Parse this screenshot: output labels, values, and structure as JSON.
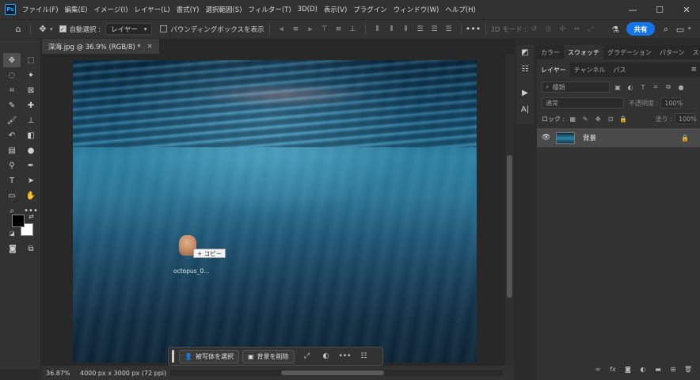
{
  "menubar": {
    "app_icon": "Ps",
    "items": [
      "ファイル(F)",
      "編集(E)",
      "イメージ(I)",
      "レイヤー(L)",
      "書式(Y)",
      "選択範囲(S)",
      "フィルター(T)",
      "3D(D)",
      "表示(V)",
      "プラグイン",
      "ウィンドウ(W)",
      "ヘルプ(H)"
    ],
    "window_controls": [
      "—",
      "☐",
      "✕"
    ]
  },
  "options": {
    "auto_select_label": "自動選択 :",
    "auto_select_target": "レイヤー",
    "bbox_label": "バウンディングボックスを表示",
    "mode_3d_label": "3D モード :",
    "share_label": "共有"
  },
  "document": {
    "tab_title": "深海.jpg @ 36.9% (RGB/8) *",
    "close_glyph": "×",
    "drag_file_label": "octopus_0...",
    "copy_tooltip": "+ コピー"
  },
  "taskbar": {
    "select_subject": "被写体を選択",
    "remove_bg": "背景を削除",
    "more": "•••"
  },
  "status": {
    "zoom": "36.87%",
    "doc_size": "4000 px x 3000 px (72 ppi)",
    "arrow": "›"
  },
  "panels": {
    "top_tabs": [
      "カラー",
      "スウォッチ",
      "グラデーション",
      "パターン",
      "スタイル"
    ],
    "top_active": 1,
    "layer_tabs": [
      "レイヤー",
      "チャンネル",
      "パス"
    ],
    "kind_filter": "種類",
    "blend_mode": "通常",
    "opacity_label": "不透明度 :",
    "opacity_value": "100%",
    "lock_label": "ロック :",
    "fill_label": "塗り :",
    "fill_value": "100%",
    "layer_name": "背景"
  },
  "icons": {
    "home": "home-icon",
    "move": "move-icon",
    "search": "search-icon",
    "eye": "eye-icon",
    "lock": "lock-icon"
  }
}
